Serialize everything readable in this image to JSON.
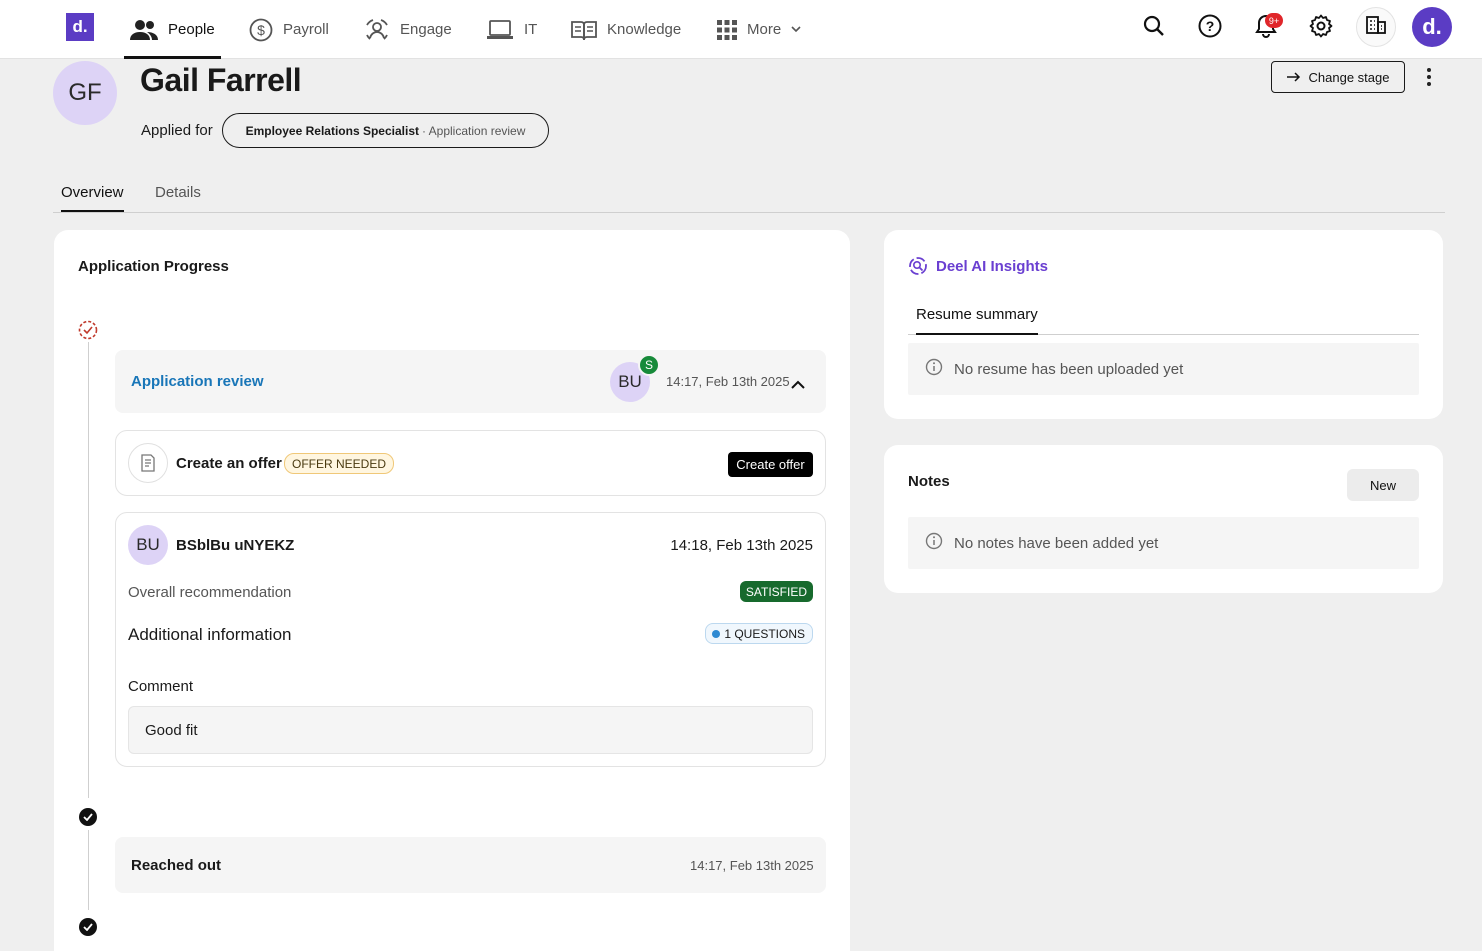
{
  "nav": {
    "logo": "d.",
    "items": [
      {
        "label": "People",
        "icon": "people-icon",
        "active": true
      },
      {
        "label": "Payroll",
        "icon": "dollar-icon"
      },
      {
        "label": "Engage",
        "icon": "engage-icon"
      },
      {
        "label": "IT",
        "icon": "laptop-icon"
      },
      {
        "label": "Knowledge",
        "icon": "book-icon"
      },
      {
        "label": "More",
        "icon": "grid-icon"
      }
    ],
    "notification_count": "9+",
    "user_initial": "d."
  },
  "candidate": {
    "initials": "GF",
    "name": "Gail Farrell",
    "applied_label": "Applied for",
    "role": "Employee Relations Specialist",
    "stage_suffix": "· Application review",
    "change_stage_label": "Change stage"
  },
  "tabs": [
    "Overview",
    "Details"
  ],
  "progress": {
    "title": "Application Progress",
    "stages": [
      {
        "name": "Application review",
        "assignee_initials": "BU",
        "assignee_badge": "S",
        "date": "14:17, Feb 13th 2025"
      },
      {
        "name": "Reached out",
        "date": "14:17, Feb 13th 2025"
      }
    ],
    "offer": {
      "title": "Create an offer",
      "badge": "OFFER NEEDED",
      "button": "Create offer"
    },
    "review": {
      "initials": "BU",
      "name": "BSblBu uNYEKZ",
      "date": "14:18, Feb 13th 2025",
      "recommendation_label": "Overall recommendation",
      "recommendation": "SATISFIED",
      "additional_info": "Additional information",
      "questions_badge": "1 QUESTIONS",
      "comment_label": "Comment",
      "comment": "Good fit"
    }
  },
  "ai": {
    "title": "Deel AI Insights",
    "tab": "Resume summary",
    "empty": "No resume has been uploaded yet"
  },
  "notes": {
    "title": "Notes",
    "new_button": "New",
    "empty": "No notes have been added yet"
  },
  "colors": {
    "brand": "#5b3cc4",
    "link": "#1976b8",
    "success": "#176a2d",
    "alert": "#e0262a"
  }
}
